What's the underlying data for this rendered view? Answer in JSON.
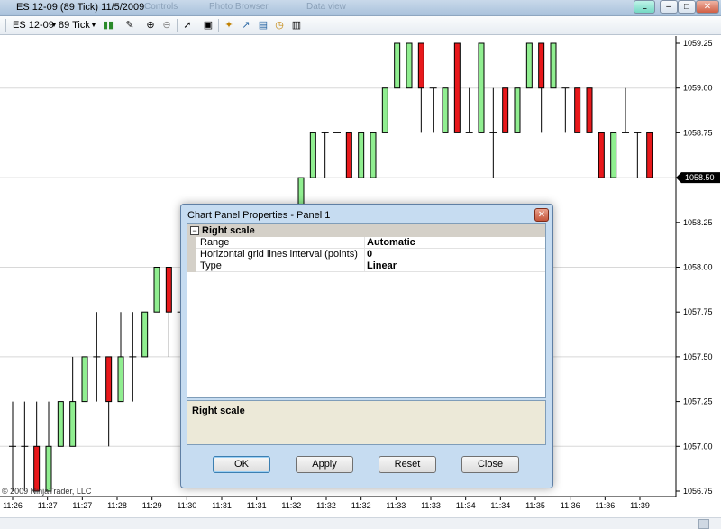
{
  "window": {
    "title": "ES 12-09 (89 Tick)  11/5/2009",
    "ghost_tabs": [
      "Controls",
      "Photo Browser",
      "Data view"
    ],
    "status_letter": "L"
  },
  "toolbar": {
    "instrument": "ES 12-09",
    "interval": "89 Tick"
  },
  "chart_data": {
    "type": "candlestick",
    "x_ticks": [
      "11:26",
      "11:27",
      "11:27",
      "11:28",
      "11:29",
      "11:30",
      "11:31",
      "11:31",
      "11:32",
      "11:32",
      "11:32",
      "11:33",
      "11:33",
      "11:34",
      "11:34",
      "11:35",
      "11:36",
      "11:36",
      "11:39"
    ],
    "y_ticks": [
      "1059.25",
      "1059.00",
      "1058.75",
      "1058.50",
      "1058.25",
      "1058.00",
      "1057.75",
      "1057.50",
      "1057.25",
      "1057.00",
      "1056.75"
    ],
    "ylim": [
      1056.75,
      1059.25
    ],
    "last_price": "1058.50",
    "colors": {
      "up": "#90ee90",
      "down": "#e8181b",
      "wick": "#000000",
      "grid": "#d8d8d8"
    }
  },
  "copyright": "© 2009 NinjaTrader, LLC",
  "dialog": {
    "title": "Chart Panel Properties - Panel 1",
    "category": "Right scale",
    "rows": [
      {
        "key": "Range",
        "value": "Automatic"
      },
      {
        "key": "Horizontal grid lines interval (points)",
        "value": "0"
      },
      {
        "key": "Type",
        "value": "Linear"
      }
    ],
    "description_title": "Right scale",
    "buttons": {
      "ok": "OK",
      "apply": "Apply",
      "reset": "Reset",
      "close": "Close"
    }
  }
}
